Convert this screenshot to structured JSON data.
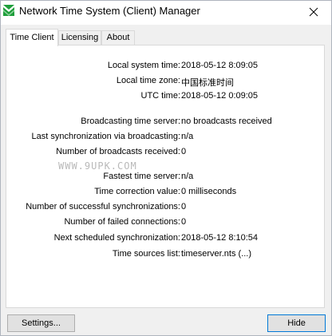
{
  "window": {
    "title": "Network Time System (Client) Manager",
    "accent_color": "#1e9e3a"
  },
  "tabs": [
    {
      "label": "Time Client",
      "active": true
    },
    {
      "label": "Licensing",
      "active": false
    },
    {
      "label": "About",
      "active": false
    }
  ],
  "rows": [
    {
      "label": "Local system time:",
      "value": "2018-05-12 8:09:05"
    },
    {
      "label": "Local time zone:",
      "value": "中国标准时间"
    },
    {
      "label": "UTC time:",
      "value": "2018-05-12 0:09:05"
    },
    {
      "label": "Broadcasting time server:",
      "value": "no broadcasts received"
    },
    {
      "label": "Last synchronization via broadcasting:",
      "value": "n/a"
    },
    {
      "label": "Number of broadcasts received:",
      "value": "0"
    },
    {
      "label": "Fastest time server:",
      "value": "n/a"
    },
    {
      "label": "Time correction value:",
      "value": "0 milliseconds"
    },
    {
      "label": "Number of successful synchronizations:",
      "value": "0"
    },
    {
      "label": "Number of failed connections:",
      "value": "0"
    },
    {
      "label": "Next scheduled synchronization:",
      "value": "2018-05-12 8:10:54"
    },
    {
      "label": "Time sources list:",
      "value": "timeserver.nts (...)"
    }
  ],
  "buttons": {
    "settings": "Settings...",
    "hide": "Hide"
  },
  "watermark": "WWW.9UPK.COM",
  "icons": {
    "app": "ntp-clock-icon",
    "close": "close-icon"
  }
}
